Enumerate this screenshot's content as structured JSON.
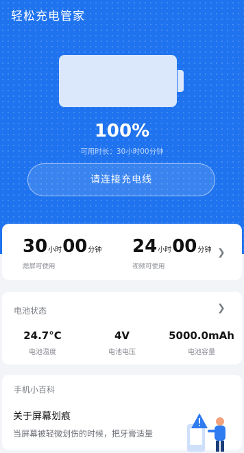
{
  "header": {
    "app_title": "轻松充电管家"
  },
  "battery": {
    "level_percent": 100,
    "percent_text": "100%",
    "available_time": "可用时长：30小时00分钟"
  },
  "connect_button": {
    "label": "请连接充电线"
  },
  "usage_times": {
    "screen_off": {
      "hours": "30",
      "hour_unit": "小时",
      "minutes": "00",
      "minute_unit": "分钟",
      "label": "熄屏可使用"
    },
    "video": {
      "hours": "24",
      "hour_unit": "小时",
      "minutes": "00",
      "minute_unit": "分钟",
      "label": "视频可使用"
    }
  },
  "battery_status": {
    "title": "电池状态",
    "items": [
      {
        "value": "24.7°C",
        "label": "电池温度"
      },
      {
        "value": "4V",
        "label": "电池电压"
      },
      {
        "value": "5000.0mAh",
        "label": "电池容量"
      }
    ]
  },
  "tips": {
    "section_title": "手机小百科",
    "heading": "关于屏幕划痕",
    "body": "当屏幕被轻微划伤的时候，把牙膏适量"
  },
  "colors": {
    "primary": "#1f73ee",
    "page_background": "#f3f4f8"
  }
}
